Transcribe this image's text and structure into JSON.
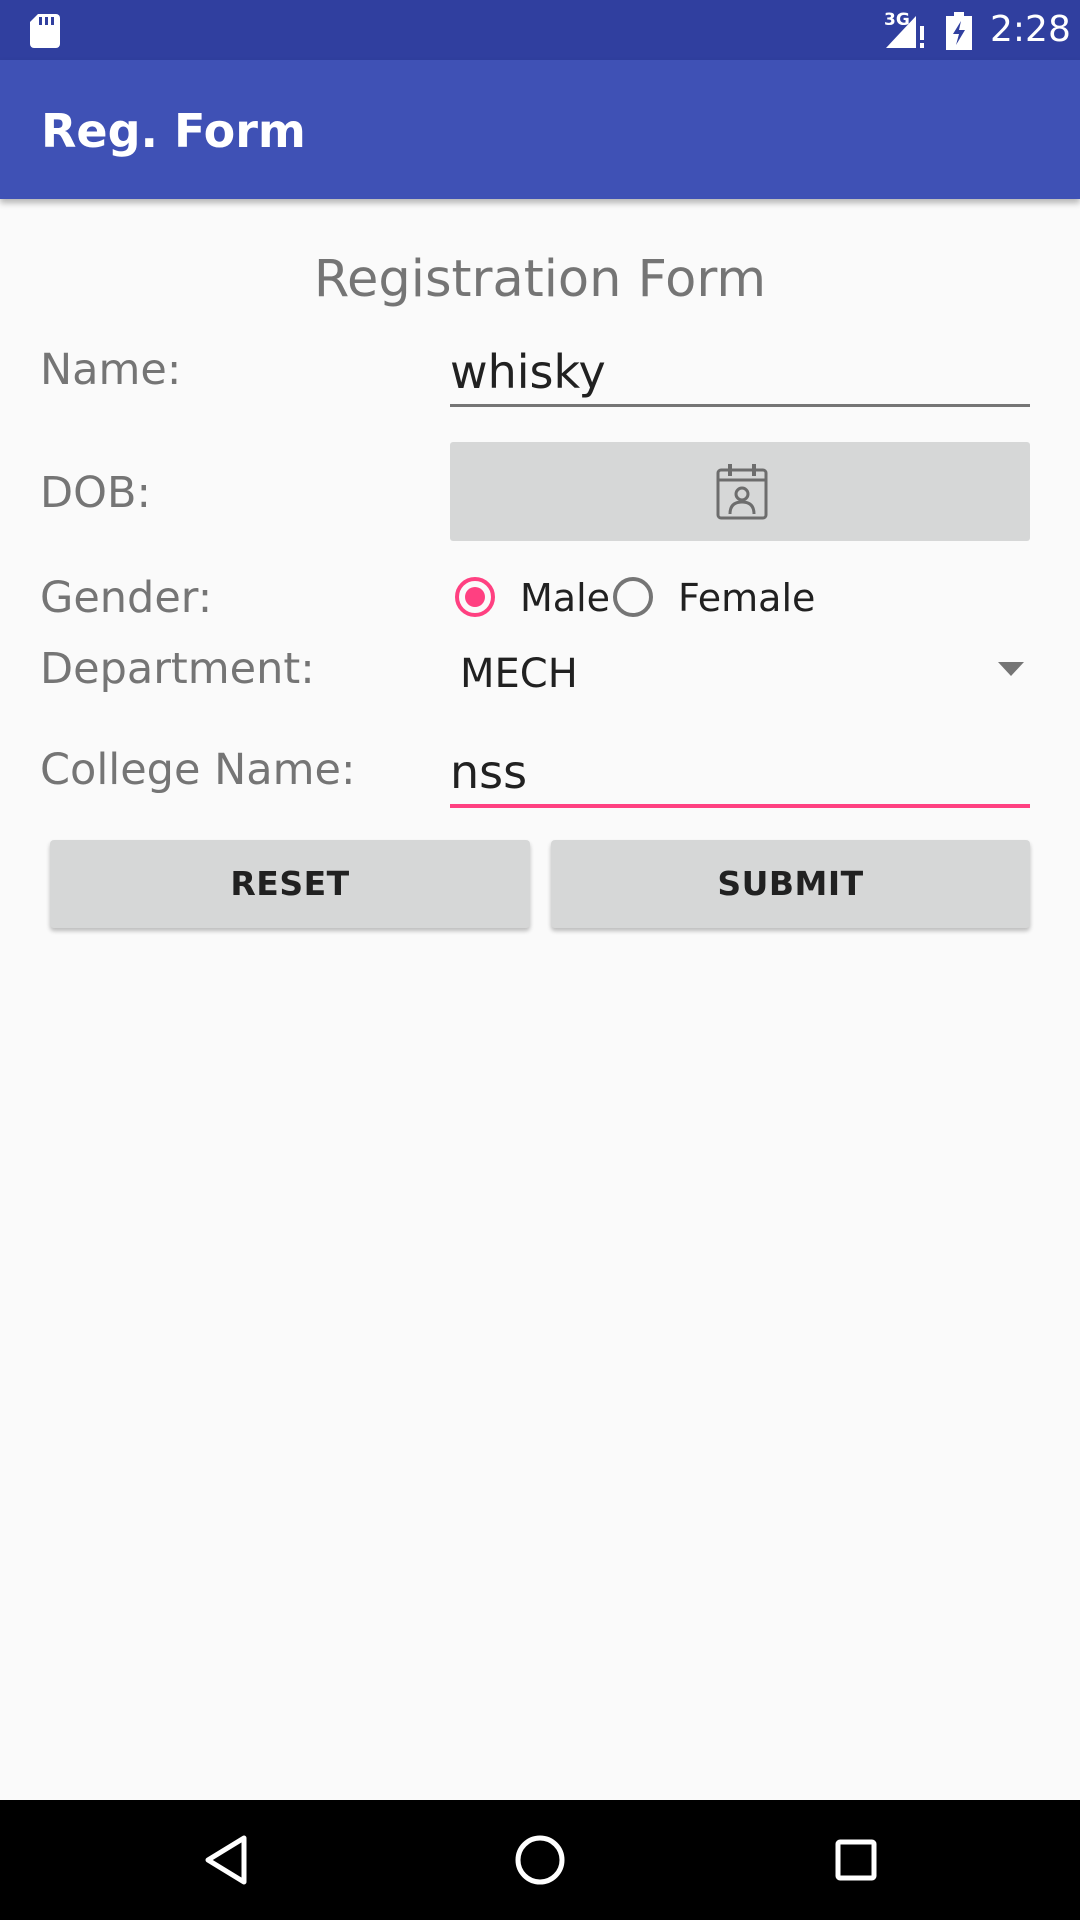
{
  "status_bar": {
    "network_type": "3G",
    "time": "2:28",
    "icons": [
      "sd-card-icon",
      "signal-icon",
      "battery-icon"
    ]
  },
  "app_bar": {
    "title": "Reg. Form"
  },
  "form": {
    "title": "Registration Form",
    "name_label": "Name:",
    "name_value": "whisky",
    "dob_label": "DOB:",
    "dob_icon": "calendar-contact-icon",
    "gender_label": "Gender:",
    "gender_options": [
      {
        "label": "Male",
        "selected": true
      },
      {
        "label": "Female",
        "selected": false
      }
    ],
    "department_label": "Department:",
    "department_value": "MECH",
    "college_label": "College Name:",
    "college_value": "nss"
  },
  "buttons": {
    "reset": "RESET",
    "submit": "SUBMIT"
  },
  "nav_bar": {
    "icons": [
      "back-icon",
      "home-icon",
      "recents-icon"
    ]
  },
  "colors": {
    "status_bar": "#303f9f",
    "app_bar": "#3f51b5",
    "accent": "#ff4081",
    "button_bg": "#d6d7d7",
    "label_text": "#757575"
  }
}
